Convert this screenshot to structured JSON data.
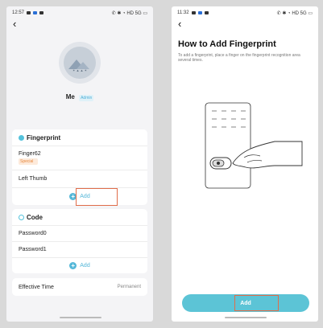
{
  "left": {
    "status_time": "12:57",
    "status_icons": "✆ ✱ ◔ HD 5G ▭",
    "back_glyph": "‹",
    "user_name": "Me",
    "user_role": "Admin",
    "avatar_text": "✶ ▲ ▲ ✶",
    "fingerprint": {
      "title": "Fingerprint",
      "items": [
        {
          "name": "Finger62",
          "tag": "Special"
        },
        {
          "name": "Left Thumb"
        }
      ],
      "add_label": "Add"
    },
    "code": {
      "title": "Code",
      "items": [
        "Password0",
        "Password1"
      ],
      "add_label": "Add"
    },
    "effective": {
      "label": "Effective Time",
      "value": "Permanent"
    }
  },
  "right": {
    "status_time": "11:32",
    "status_icons": "✆ ✱ ◔ HD 5G ▭",
    "back_glyph": "‹",
    "title": "How to Add Fingerprint",
    "description": "To add a fingerprint, place a finger on the fingerprint recognition area several times.",
    "add_button_label": "Add"
  },
  "colors": {
    "accent": "#54b7d8",
    "button": "#5cc4d6",
    "highlight": "#e06d4a",
    "tag_text": "#e7883d"
  },
  "icons": {
    "fingerprint_section": "fingerprint-icon",
    "code_section": "code-icon",
    "add": "plus-circle-icon",
    "back": "back-arrow-icon"
  }
}
